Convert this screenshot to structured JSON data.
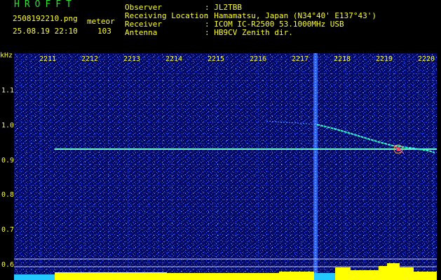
{
  "app": {
    "title": "HROFFT"
  },
  "capture": {
    "filename": "2508192210.png",
    "category": "meteor",
    "timestamp": "25.08.19 22:10",
    "count": "103"
  },
  "station": [
    {
      "key": "Observer",
      "value": ": JL2TBB"
    },
    {
      "key": "Receiving Location",
      "value": ": Hamamatsu, Japan (N34°40' E137°43')"
    },
    {
      "key": "Receiver",
      "value": ": ICOM IC-R2500 53.1000MHz USB"
    },
    {
      "key": "Antenna",
      "value": ": HB9CV Zenith dir."
    }
  ],
  "axes": {
    "y_unit": "kHz",
    "y_ticks": [
      "1.1",
      "1.0",
      "0.9",
      "0.8",
      "0.7",
      "0.6"
    ],
    "x_ticks": [
      "2211",
      "2212",
      "2213",
      "2214",
      "2215",
      "2216",
      "2217",
      "2218",
      "2219",
      "2220"
    ]
  },
  "colors": {
    "background": "#000000",
    "text": "#ffff33",
    "title": "#33dd33",
    "spectrogram_bg": "#020a66",
    "carrier": "#66ffcc",
    "meteor_echo": "#33ffcc",
    "interference": "#2266ff",
    "level_bar": "#ffff00"
  }
}
